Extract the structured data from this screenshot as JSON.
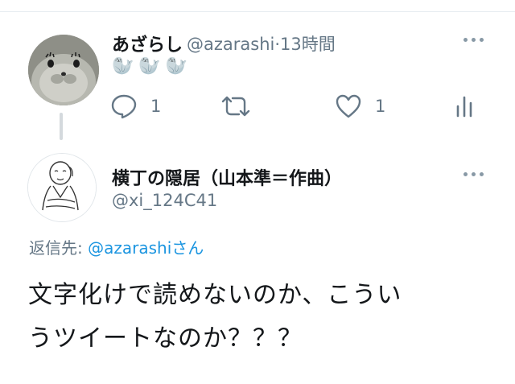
{
  "tweet": {
    "display_name": "あざらし",
    "handle": "@azarashi",
    "separator": "·",
    "time": "13時間",
    "body_emoji": "🦭🦭🦭",
    "reply_count": "1",
    "like_count": "1"
  },
  "reply": {
    "display_name": "横丁の隠居（山本準＝作曲）",
    "handle": "@xi_124C41",
    "reply_prefix": "返信先: ",
    "reply_mention": "@azarashi",
    "reply_suffix": "さん",
    "body_line1": "文字化けで読めないのか、こうい",
    "body_line2": "うツイートなのか？？？"
  },
  "icons": {
    "reply": "reply-icon",
    "retweet": "retweet-icon",
    "like": "heart-icon",
    "analytics": "analytics-icon",
    "more": "more-icon"
  },
  "colors": {
    "accent": "#1b95e0",
    "secondary_text": "#657786",
    "primary_text": "#14171a"
  }
}
